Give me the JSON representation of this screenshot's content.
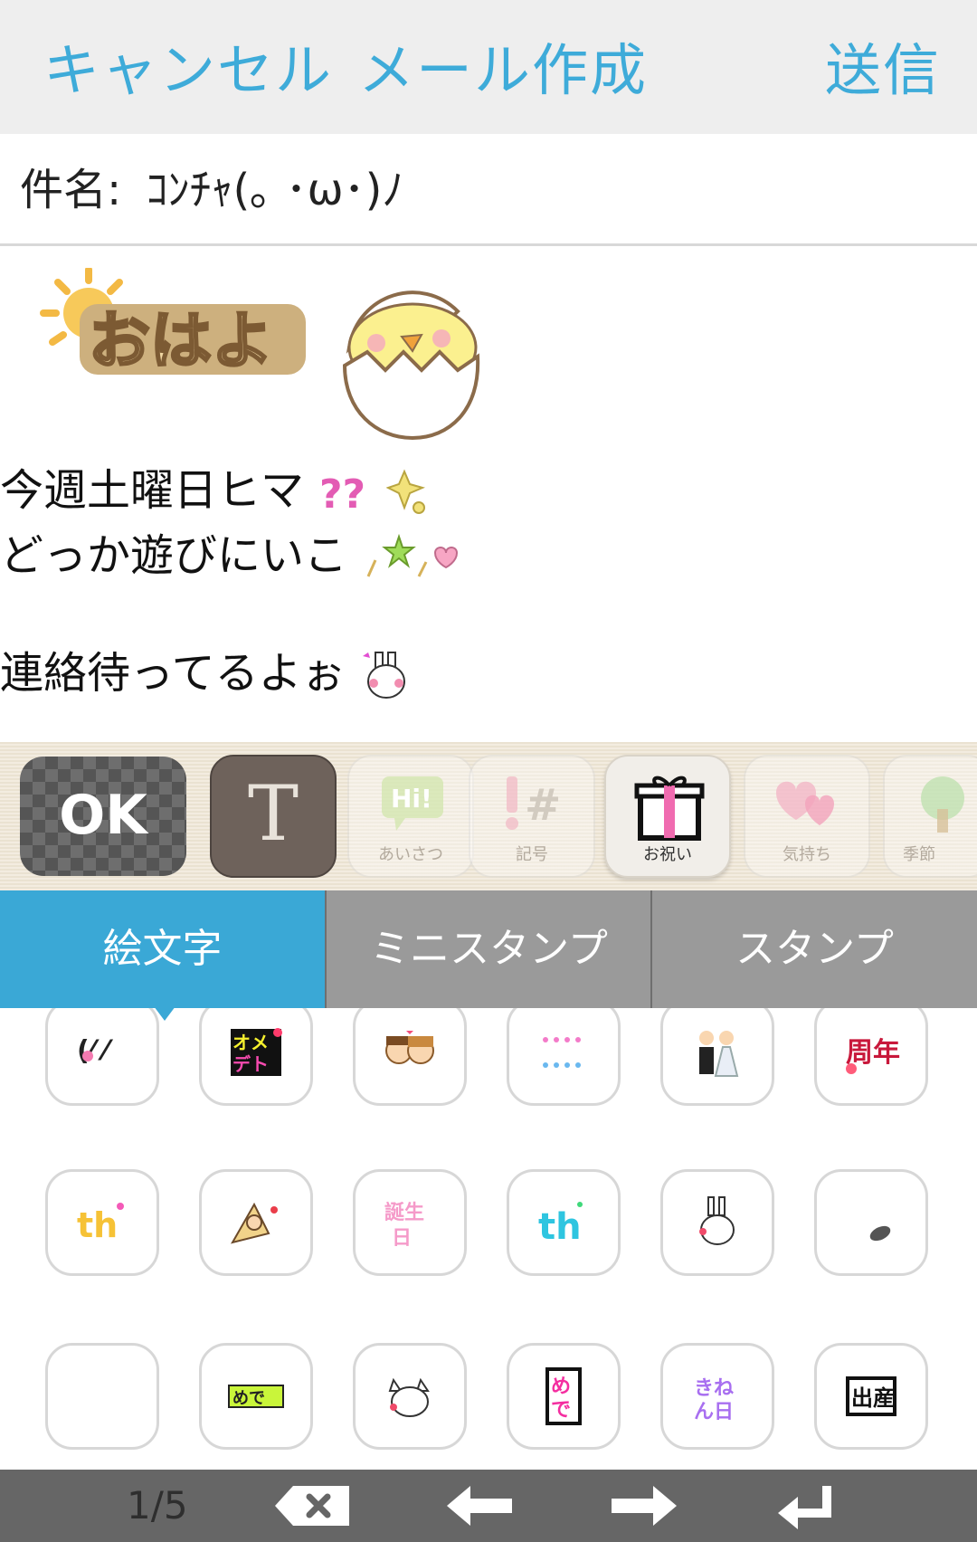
{
  "header": {
    "cancel_label": "キャンセル",
    "title": "メール作成",
    "send_label": "送信"
  },
  "subject": {
    "label": "件名:",
    "value": "ｺﾝﾁｬ(｡ ･ω･)ﾉ"
  },
  "body": {
    "lines": [
      "今週土曜日ヒマ",
      "どっか遊びにいこ",
      "",
      "連絡待ってるよぉ"
    ]
  },
  "toolbar": {
    "ok_label": "OK",
    "text_label": "T",
    "categories": [
      {
        "label": "あいさつ",
        "icon": "hi-bubble-icon"
      },
      {
        "label": "記号",
        "icon": "symbols-icon"
      },
      {
        "label": "お祝い",
        "icon": "gift-icon",
        "selected": true
      },
      {
        "label": "気持ち",
        "icon": "hearts-icon"
      },
      {
        "label": "季節",
        "icon": "tree-icon"
      }
    ]
  },
  "tabs": {
    "items": [
      "絵文字",
      "ミニスタンプ",
      "スタンプ"
    ],
    "active": "絵文字"
  },
  "emoji_grid": {
    "rows": [
      [
        "blushing-face-emoji",
        "omedeto-rainbow-emoji",
        "couple-emoji",
        "hearts-sparkle-emoji",
        "wedding-couple-emoji",
        "anniversary-emoji"
      ],
      [
        "thanks-rainbow-emoji",
        "party-cracker-emoji",
        "birthday-text-emoji",
        "thanks-cyan-emoji",
        "bunny-emoji",
        "feather-emoji"
      ],
      [
        "blank-emoji",
        "omedeto-banner-emoji",
        "white-cat-emoji",
        "omedeto-vertical-emoji",
        "kinenbi-emoji",
        "shussan-emoji"
      ]
    ]
  },
  "bottom_bar": {
    "page_indicator": "1/5",
    "icons": [
      "backspace-icon",
      "arrow-left-icon",
      "arrow-right-icon",
      "enter-icon"
    ]
  },
  "colors": {
    "accent": "#3aa8d6",
    "header_bg": "#eeeeee",
    "tab_bg": "#9a9a9a",
    "bottom_bar_bg": "#666666"
  }
}
